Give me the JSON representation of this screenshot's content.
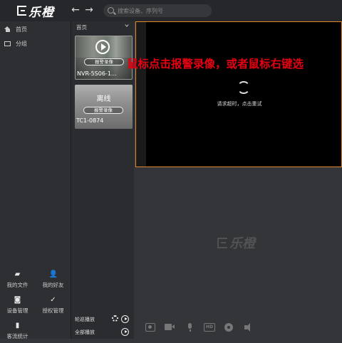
{
  "app": {
    "logo_text": "乐橙"
  },
  "search": {
    "placeholder": "搜索设备、序列号"
  },
  "sidebar": {
    "items": [
      {
        "label": "首页",
        "icon": "home-icon"
      },
      {
        "label": "分组",
        "icon": "folder-icon"
      }
    ],
    "bottom": [
      {
        "label": "我的文件",
        "icon": "file-folder-icon"
      },
      {
        "label": "我的好友",
        "icon": "friends-icon"
      },
      {
        "label": "设备管理",
        "icon": "device-camera-icon"
      },
      {
        "label": "授权管理",
        "icon": "shield-check-icon"
      },
      {
        "label": "客流统计",
        "icon": "bar-chart-icon"
      }
    ]
  },
  "device_panel": {
    "header": "首页",
    "devices": [
      {
        "name": "NVR-5S06-1...",
        "record_label": "报警录像",
        "status": "online"
      },
      {
        "name": "TC1-0874",
        "record_label": "报警录像",
        "status": "离线"
      }
    ],
    "bottom": [
      {
        "label": "轮巡播放"
      },
      {
        "label": "全部播放"
      }
    ]
  },
  "player": {
    "message": "请求超时，点击重试",
    "overlay_text": "鼠标点击报警录像，或者鼠标右键选",
    "watermark": "乐橙"
  },
  "colors": {
    "accent_border": "#e08a2a",
    "overlay_red": "#e60012"
  }
}
